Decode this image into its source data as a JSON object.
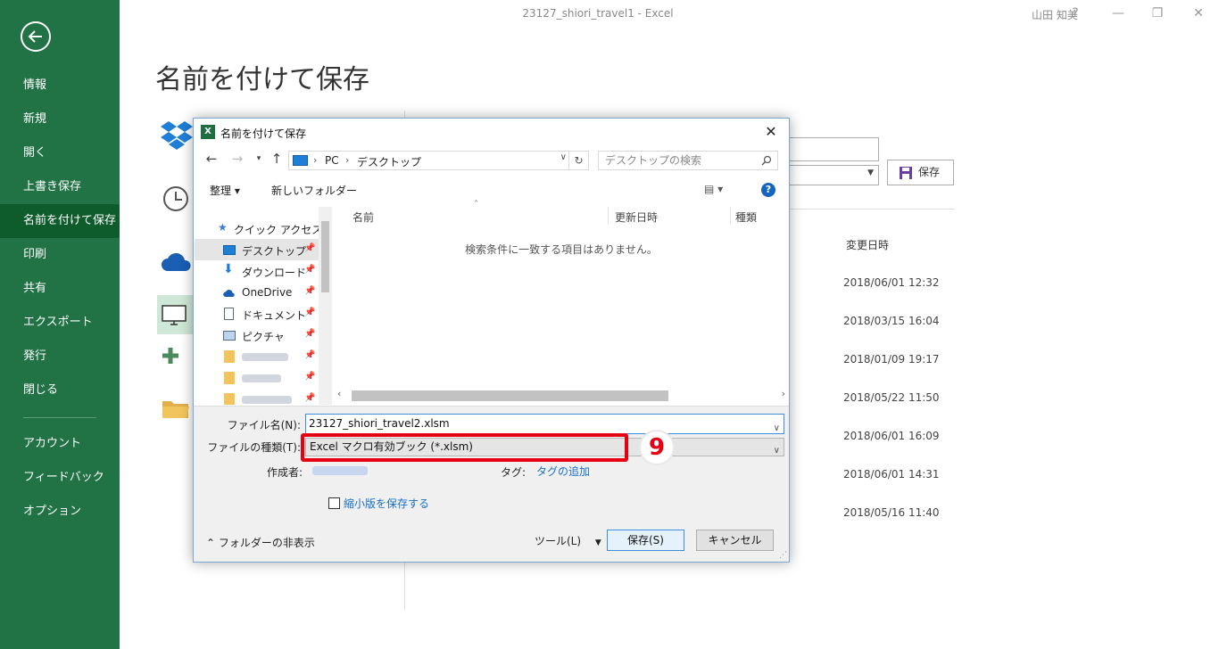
{
  "window": {
    "title": "23127_shiori_travel1  -  Excel",
    "user": "山田 知美",
    "help": "?",
    "minimize": "—",
    "restore": "❐",
    "close": "✕"
  },
  "sidebar": {
    "items": [
      {
        "label": "情報"
      },
      {
        "label": "新規"
      },
      {
        "label": "開く"
      },
      {
        "label": "上書き保存"
      },
      {
        "label": "名前を付けて保存"
      },
      {
        "label": "印刷"
      },
      {
        "label": "共有"
      },
      {
        "label": "エクスポート"
      },
      {
        "label": "発行"
      },
      {
        "label": "閉じる"
      },
      {
        "label": "アカウント"
      },
      {
        "label": "フィードバック"
      },
      {
        "label": "オプション"
      }
    ],
    "active_index": 4
  },
  "backstage": {
    "title": "名前を付けて保存",
    "save_label": "保存",
    "date_header": "変更日時",
    "dates": [
      "2018/06/01 12:32",
      "2018/03/15 16:04",
      "2018/01/09 19:17",
      "2018/05/22 11:50",
      "2018/06/01 16:09",
      "2018/06/01 14:31",
      "2018/05/16 11:40"
    ]
  },
  "dialog": {
    "title": "名前を付けて保存",
    "close": "✕",
    "path": [
      "PC",
      "デスクトップ"
    ],
    "search_placeholder": "デスクトップの検索",
    "organize_label": "整理 ▾",
    "new_folder_label": "新しいフォルダー",
    "nav": {
      "quick_access": "クイック アクセス",
      "items": [
        {
          "label": "デスクトップ"
        },
        {
          "label": "ダウンロード"
        },
        {
          "label": "OneDrive"
        },
        {
          "label": "ドキュメント"
        },
        {
          "label": "ピクチャ"
        }
      ]
    },
    "columns": [
      "名前",
      "更新日時",
      "種類"
    ],
    "empty_message": "検索条件に一致する項目はありません。",
    "filename_label": "ファイル名(N):",
    "filename_value": "23127_shiori_travel2.xlsm",
    "filetype_label": "ファイルの種類(T):",
    "filetype_value": "Excel マクロ有効ブック (*.xlsm)",
    "author_label": "作成者:",
    "tag_label": "タグ:",
    "tag_link": "タグの追加",
    "thumbnail_label": "縮小版を保存する",
    "hide_folders_label": "フォルダーの非表示",
    "tools_label": "ツール(L)",
    "save_label": "保存(S)",
    "cancel_label": "キャンセル",
    "step_badge": "9"
  },
  "colors": {
    "excel_green": "#217346",
    "active_item": "#0e5b2c",
    "highlight_red": "#e60012",
    "link_blue": "#1a6fc4"
  }
}
